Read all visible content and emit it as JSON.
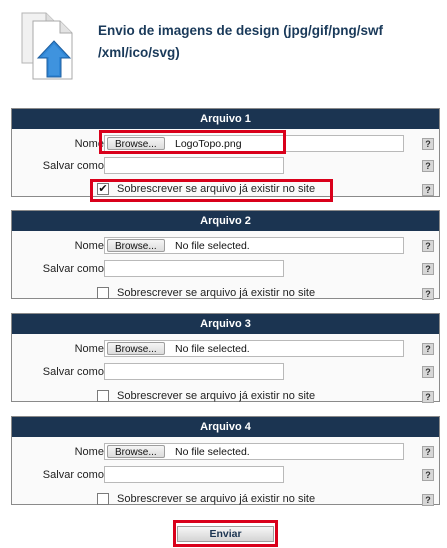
{
  "page": {
    "title": "Envio de imagens de design (jpg/gif/png/swf/xml/ico/svg)",
    "title_line1": "Envio de imagens de design (jpg/gif/png/swf",
    "title_line2": "/xml/ico/svg)",
    "header_icon": "upload-files-icon"
  },
  "labels": {
    "name": "Nome:",
    "save_as": "Salvar como:",
    "browse": "Browse...",
    "overwrite": "Sobrescrever se arquivo já existir no site",
    "help": "?"
  },
  "panels": [
    {
      "title": "Arquivo 1",
      "file_status": "LogoTopo.png",
      "save_as_value": "",
      "overwrite_checked": true
    },
    {
      "title": "Arquivo 2",
      "file_status": "No file selected.",
      "save_as_value": "",
      "overwrite_checked": false
    },
    {
      "title": "Arquivo 3",
      "file_status": "No file selected.",
      "save_as_value": "",
      "overwrite_checked": false
    },
    {
      "title": "Arquivo 4",
      "file_status": "No file selected.",
      "save_as_value": "",
      "overwrite_checked": false
    }
  ],
  "submit": {
    "label": "Enviar"
  },
  "colors": {
    "panel_header_bg": "#1b3451",
    "title_text": "#1a3a5a",
    "highlight": "#d9001b",
    "upload_arrow": "#2f86d6"
  }
}
